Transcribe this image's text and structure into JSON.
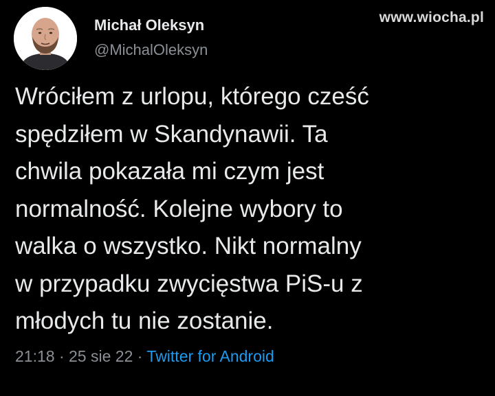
{
  "watermark": {
    "text": "www.wiocha.pl"
  },
  "tweet": {
    "author": {
      "display_name": "Michał Oleksyn",
      "handle": "@MichalOleksyn",
      "avatar_icon": "user-avatar-photo"
    },
    "text_lines": [
      "Wróciłem z urlopu, którego cześć",
      "spędziłem w Skandynawii. Ta",
      "chwila pokazała mi czym jest",
      "normalność. Kolejne wybory to",
      "walka o wszystko. Nikt normalny",
      "w przypadku zwycięstwa PiS-u z",
      "młodych tu nie zostanie."
    ],
    "meta": {
      "time": "21:18",
      "separator": "·",
      "date": "25 sie 22",
      "source": "Twitter for Android"
    }
  },
  "colors": {
    "background": "#000000",
    "text": "#e7e9ea",
    "muted": "#8b9096",
    "link": "#1d9bf0"
  }
}
